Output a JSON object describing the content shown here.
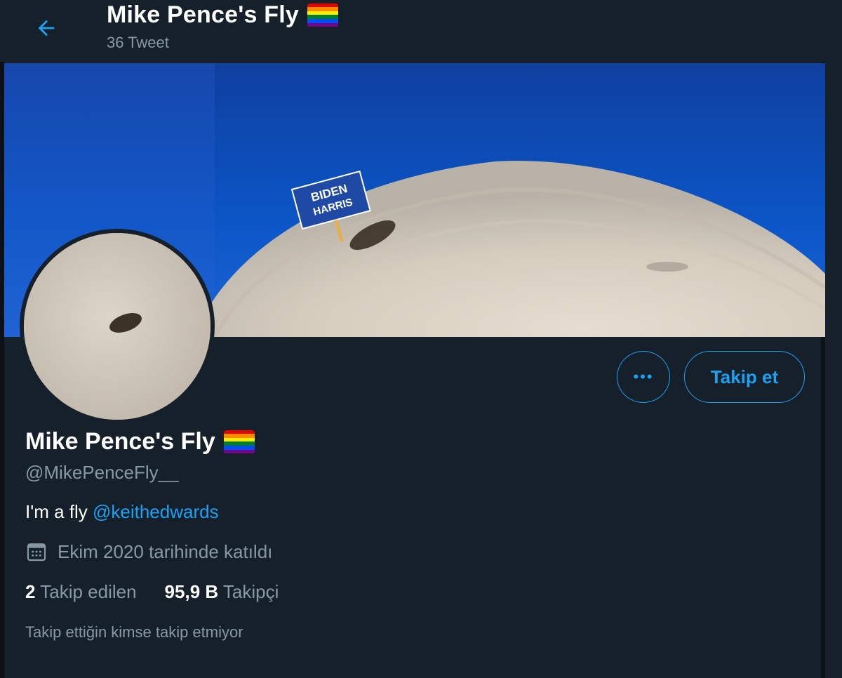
{
  "header": {
    "title": "Mike Pence's Fly",
    "tweet_count": "36 Tweet"
  },
  "banner": {
    "sign_line1": "BIDEN",
    "sign_line2": "HARRIS"
  },
  "actions": {
    "more_label": "•••",
    "follow_label": "Takip et"
  },
  "profile": {
    "name": "Mike Pence's Fly",
    "handle": "@MikePenceFly__",
    "bio_text": "I'm a fly ",
    "bio_mention": "@keithedwards",
    "joined": "Ekim 2020 tarihinde katıldı",
    "following_count": "2",
    "following_label": "Takip edilen",
    "followers_count": "95,9 B",
    "followers_label": "Takipçi",
    "mutual_note": "Takip ettiğin kimse takip etmiyor"
  },
  "icons": {
    "back": "arrow-left-icon",
    "calendar": "calendar-icon",
    "flag": "rainbow-flag-icon"
  },
  "colors": {
    "background": "#15202b",
    "accent": "#1da1f2",
    "secondary_text": "#8899a6",
    "flag": [
      "#e40303",
      "#ff8c00",
      "#ffed00",
      "#008026",
      "#004dff",
      "#750787"
    ]
  }
}
